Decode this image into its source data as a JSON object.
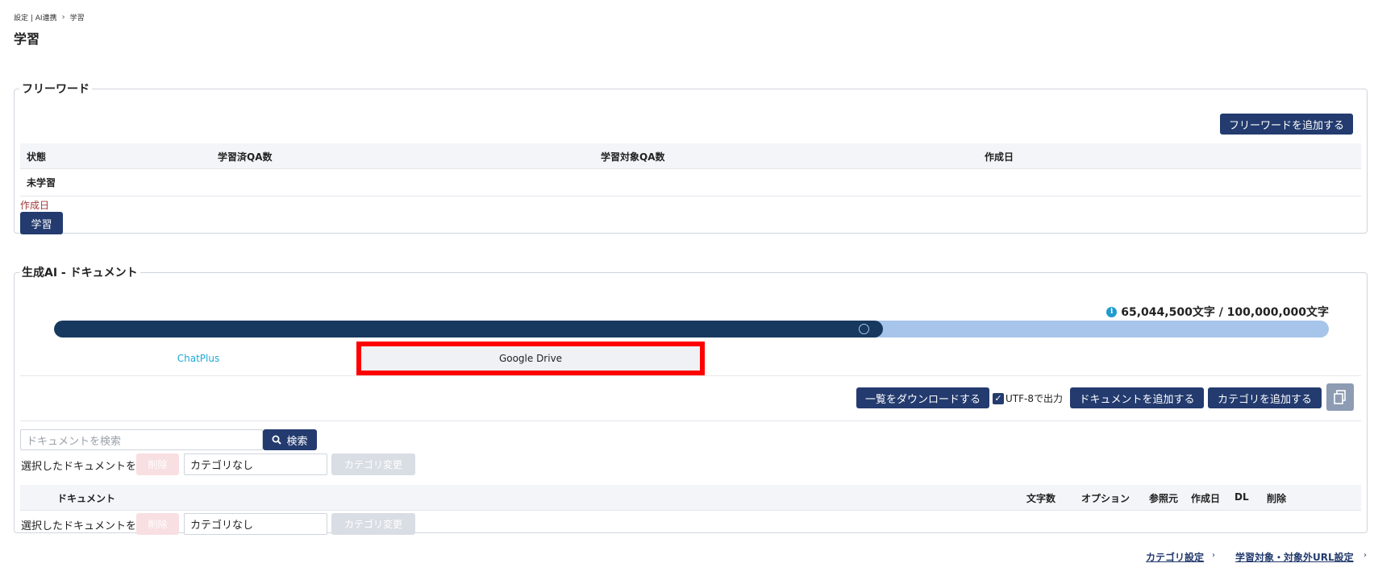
{
  "breadcrumb": {
    "parent": "設定 | AI連携",
    "current": "学習"
  },
  "page_title": "学習",
  "freeword": {
    "legend": "フリーワード",
    "add_button": "フリーワードを追加する",
    "columns": [
      "状態",
      "学習済QA数",
      "学習対象QA数",
      "作成日"
    ],
    "row": {
      "status": "未学習"
    },
    "created_label": "作成日",
    "learn_button": "学習"
  },
  "docs": {
    "legend": "生成AI - ドキュメント",
    "usage_text": "65,044,500文字 / 100,000,000文字",
    "usage_fraction": 0.6504,
    "tabs": {
      "chatplus": "ChatPlus",
      "gdrive": "Google Drive"
    },
    "download_button": "一覧をダウンロードする",
    "utf8_label": "UTF-8で出力",
    "add_doc_button": "ドキュメントを追加する",
    "add_category_button": "カテゴリを追加する",
    "search_placeholder": "ドキュメントを検索",
    "search_button": "検索",
    "selected_label": "選択したドキュメントを",
    "delete_button": "削除",
    "category_value": "カテゴリなし",
    "change_category_button": "カテゴリ変更",
    "columns": {
      "document": "ドキュメント",
      "chars": "文字数",
      "options": "オプション",
      "reference": "参照元",
      "created": "作成日",
      "dl": "DL",
      "delete": "削除"
    }
  },
  "footer": {
    "category_settings": "カテゴリ設定",
    "url_settings": "学習対象・対象外URL設定"
  },
  "colors": {
    "navy": "#233b6e",
    "highlight": "#ff0000",
    "progress_fill": "#18395f",
    "progress_track": "#a7c4ea",
    "link": "#1fa8d8"
  }
}
